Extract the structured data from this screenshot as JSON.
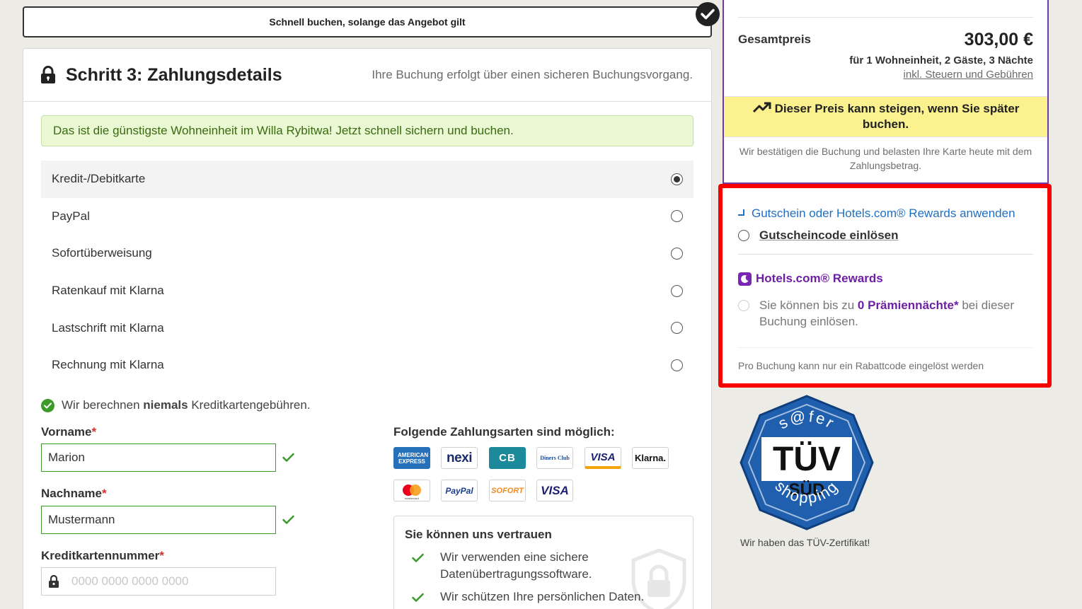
{
  "urgency": {
    "text": "Schnell buchen, solange das Angebot gilt"
  },
  "step": {
    "title": "Schritt 3: Zahlungsdetails",
    "subtitle": "Ihre Buchung erfolgt über einen sicheren Buchungsvorgang.",
    "cheapest_note": "Das ist die günstigste Wohneinheit im Willa Rybitwa! Jetzt schnell sichern und buchen."
  },
  "payment_options": [
    {
      "label": "Kredit-/Debitkarte",
      "selected": true
    },
    {
      "label": "PayPal",
      "selected": false
    },
    {
      "label": "Sofortüberweisung",
      "selected": false
    },
    {
      "label": "Ratenkauf mit Klarna",
      "selected": false
    },
    {
      "label": "Lastschrift mit Klarna",
      "selected": false
    },
    {
      "label": "Rechnung mit Klarna",
      "selected": false
    }
  ],
  "fees": {
    "prefix": "Wir berechnen ",
    "bold": "niemals",
    "suffix": " Kreditkartengebühren."
  },
  "form": {
    "first_name": {
      "label": "Vorname",
      "required": "*",
      "value": "Marion"
    },
    "last_name": {
      "label": "Nachname",
      "required": "*",
      "value": "Mustermann"
    },
    "card_number": {
      "label": "Kreditkartennummer",
      "required": "*",
      "placeholder": "0000 0000 0000 0000"
    }
  },
  "methods": {
    "title": "Folgende Zahlungsarten sind möglich:",
    "logos": [
      "AMERICAN EXPRESS",
      "nexi",
      "CB",
      "Diners Club",
      "VISA",
      "Klarna.",
      "mastercard",
      "PayPal",
      "SOFORT",
      "VISA"
    ]
  },
  "trust": {
    "title": "Sie können uns vertrauen",
    "items": [
      "Wir verwenden eine sichere Datenübertragungssoftware.",
      "Wir schützen Ihre persönlichen Daten."
    ]
  },
  "price": {
    "label": "Gesamtpreis",
    "value": "303,00 €",
    "detail": "für 1 Wohneinheit, 2 Gäste, 3 Nächte",
    "tax": "inkl. Steuern und Gebühren",
    "rise_warning": "Dieser Preis kann steigen, wenn Sie später buchen.",
    "confirm": "Wir bestätigen die Buchung und belasten Ihre Karte heute mit dem Zahlungsbetrag."
  },
  "voucher": {
    "link": "Gutschein oder Hotels.com® Rewards anwenden",
    "code_option": "Gutscheincode einlösen",
    "rewards_title": "Hotels.com® Rewards",
    "rewards_prefix": "Sie können bis zu ",
    "rewards_bold": "0 Prämiennächte*",
    "rewards_suffix": " bei dieser Buchung einlösen.",
    "footnote": "Pro Buchung kann nur ein Rabattcode eingelöst werden"
  },
  "tuv": {
    "top": "s@fer",
    "main": "TÜV",
    "sub": "SÜD",
    "bottom": "shopping",
    "caption": "Wir haben das TÜV-Zertifikat!"
  },
  "colors": {
    "brand_purple": "#6e1fa2",
    "highlight_red": "#f60000",
    "success_green": "#3a9b29",
    "warning_yellow": "#fbf28f"
  }
}
